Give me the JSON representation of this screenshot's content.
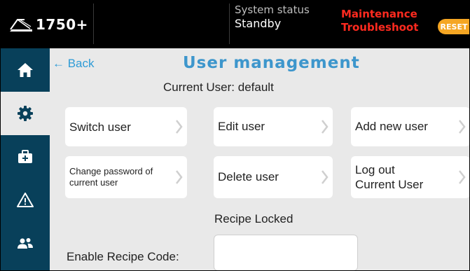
{
  "header": {
    "model": "1750+",
    "status_label": "System status",
    "status_value": "Standby",
    "alarm_lines": [
      "Maintenance",
      "Troubleshoot"
    ],
    "reset_label": "RESET",
    "alarm_color": "#ff2a1f",
    "reset_color": "#f5a623"
  },
  "sidebar": {
    "background": "#08405a",
    "items": [
      {
        "icon": "home-icon"
      },
      {
        "icon": "gear-icon",
        "active": true
      },
      {
        "icon": "toolbox-icon"
      },
      {
        "icon": "warning-icon"
      },
      {
        "icon": "users-icon"
      }
    ]
  },
  "page": {
    "back_label": "← Back",
    "title": "User management",
    "current_user": "Current User: default",
    "accent_color": "#3d96cc"
  },
  "actions": [
    {
      "label": "Switch user"
    },
    {
      "label": "Edit user"
    },
    {
      "label": "Add new user"
    },
    {
      "label": "Change password of current user"
    },
    {
      "label": "Delete user"
    },
    {
      "label": "Log out Current User"
    }
  ],
  "recipe": {
    "locked_label": "Recipe Locked",
    "code_label": "Enable Recipe Code:",
    "code_value": "",
    "code_placeholder": ""
  }
}
